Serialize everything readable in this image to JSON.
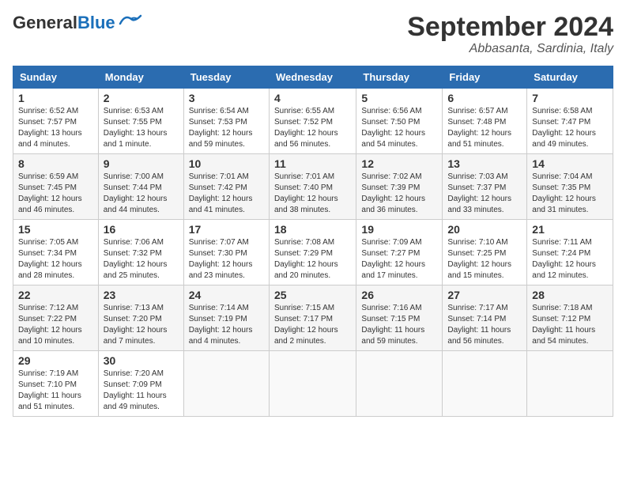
{
  "logo": {
    "text_general": "General",
    "text_blue": "Blue"
  },
  "title": "September 2024",
  "location": "Abbasanta, Sardinia, Italy",
  "days_of_week": [
    "Sunday",
    "Monday",
    "Tuesday",
    "Wednesday",
    "Thursday",
    "Friday",
    "Saturday"
  ],
  "weeks": [
    [
      {
        "day": 1,
        "sunrise": "6:52 AM",
        "sunset": "7:57 PM",
        "daylight": "13 hours and 4 minutes."
      },
      {
        "day": 2,
        "sunrise": "6:53 AM",
        "sunset": "7:55 PM",
        "daylight": "13 hours and 1 minute."
      },
      {
        "day": 3,
        "sunrise": "6:54 AM",
        "sunset": "7:53 PM",
        "daylight": "12 hours and 59 minutes."
      },
      {
        "day": 4,
        "sunrise": "6:55 AM",
        "sunset": "7:52 PM",
        "daylight": "12 hours and 56 minutes."
      },
      {
        "day": 5,
        "sunrise": "6:56 AM",
        "sunset": "7:50 PM",
        "daylight": "12 hours and 54 minutes."
      },
      {
        "day": 6,
        "sunrise": "6:57 AM",
        "sunset": "7:48 PM",
        "daylight": "12 hours and 51 minutes."
      },
      {
        "day": 7,
        "sunrise": "6:58 AM",
        "sunset": "7:47 PM",
        "daylight": "12 hours and 49 minutes."
      }
    ],
    [
      {
        "day": 8,
        "sunrise": "6:59 AM",
        "sunset": "7:45 PM",
        "daylight": "12 hours and 46 minutes."
      },
      {
        "day": 9,
        "sunrise": "7:00 AM",
        "sunset": "7:44 PM",
        "daylight": "12 hours and 44 minutes."
      },
      {
        "day": 10,
        "sunrise": "7:01 AM",
        "sunset": "7:42 PM",
        "daylight": "12 hours and 41 minutes."
      },
      {
        "day": 11,
        "sunrise": "7:01 AM",
        "sunset": "7:40 PM",
        "daylight": "12 hours and 38 minutes."
      },
      {
        "day": 12,
        "sunrise": "7:02 AM",
        "sunset": "7:39 PM",
        "daylight": "12 hours and 36 minutes."
      },
      {
        "day": 13,
        "sunrise": "7:03 AM",
        "sunset": "7:37 PM",
        "daylight": "12 hours and 33 minutes."
      },
      {
        "day": 14,
        "sunrise": "7:04 AM",
        "sunset": "7:35 PM",
        "daylight": "12 hours and 31 minutes."
      }
    ],
    [
      {
        "day": 15,
        "sunrise": "7:05 AM",
        "sunset": "7:34 PM",
        "daylight": "12 hours and 28 minutes."
      },
      {
        "day": 16,
        "sunrise": "7:06 AM",
        "sunset": "7:32 PM",
        "daylight": "12 hours and 25 minutes."
      },
      {
        "day": 17,
        "sunrise": "7:07 AM",
        "sunset": "7:30 PM",
        "daylight": "12 hours and 23 minutes."
      },
      {
        "day": 18,
        "sunrise": "7:08 AM",
        "sunset": "7:29 PM",
        "daylight": "12 hours and 20 minutes."
      },
      {
        "day": 19,
        "sunrise": "7:09 AM",
        "sunset": "7:27 PM",
        "daylight": "12 hours and 17 minutes."
      },
      {
        "day": 20,
        "sunrise": "7:10 AM",
        "sunset": "7:25 PM",
        "daylight": "12 hours and 15 minutes."
      },
      {
        "day": 21,
        "sunrise": "7:11 AM",
        "sunset": "7:24 PM",
        "daylight": "12 hours and 12 minutes."
      }
    ],
    [
      {
        "day": 22,
        "sunrise": "7:12 AM",
        "sunset": "7:22 PM",
        "daylight": "12 hours and 10 minutes."
      },
      {
        "day": 23,
        "sunrise": "7:13 AM",
        "sunset": "7:20 PM",
        "daylight": "12 hours and 7 minutes."
      },
      {
        "day": 24,
        "sunrise": "7:14 AM",
        "sunset": "7:19 PM",
        "daylight": "12 hours and 4 minutes."
      },
      {
        "day": 25,
        "sunrise": "7:15 AM",
        "sunset": "7:17 PM",
        "daylight": "12 hours and 2 minutes."
      },
      {
        "day": 26,
        "sunrise": "7:16 AM",
        "sunset": "7:15 PM",
        "daylight": "11 hours and 59 minutes."
      },
      {
        "day": 27,
        "sunrise": "7:17 AM",
        "sunset": "7:14 PM",
        "daylight": "11 hours and 56 minutes."
      },
      {
        "day": 28,
        "sunrise": "7:18 AM",
        "sunset": "7:12 PM",
        "daylight": "11 hours and 54 minutes."
      }
    ],
    [
      {
        "day": 29,
        "sunrise": "7:19 AM",
        "sunset": "7:10 PM",
        "daylight": "11 hours and 51 minutes."
      },
      {
        "day": 30,
        "sunrise": "7:20 AM",
        "sunset": "7:09 PM",
        "daylight": "11 hours and 49 minutes."
      },
      null,
      null,
      null,
      null,
      null
    ]
  ]
}
